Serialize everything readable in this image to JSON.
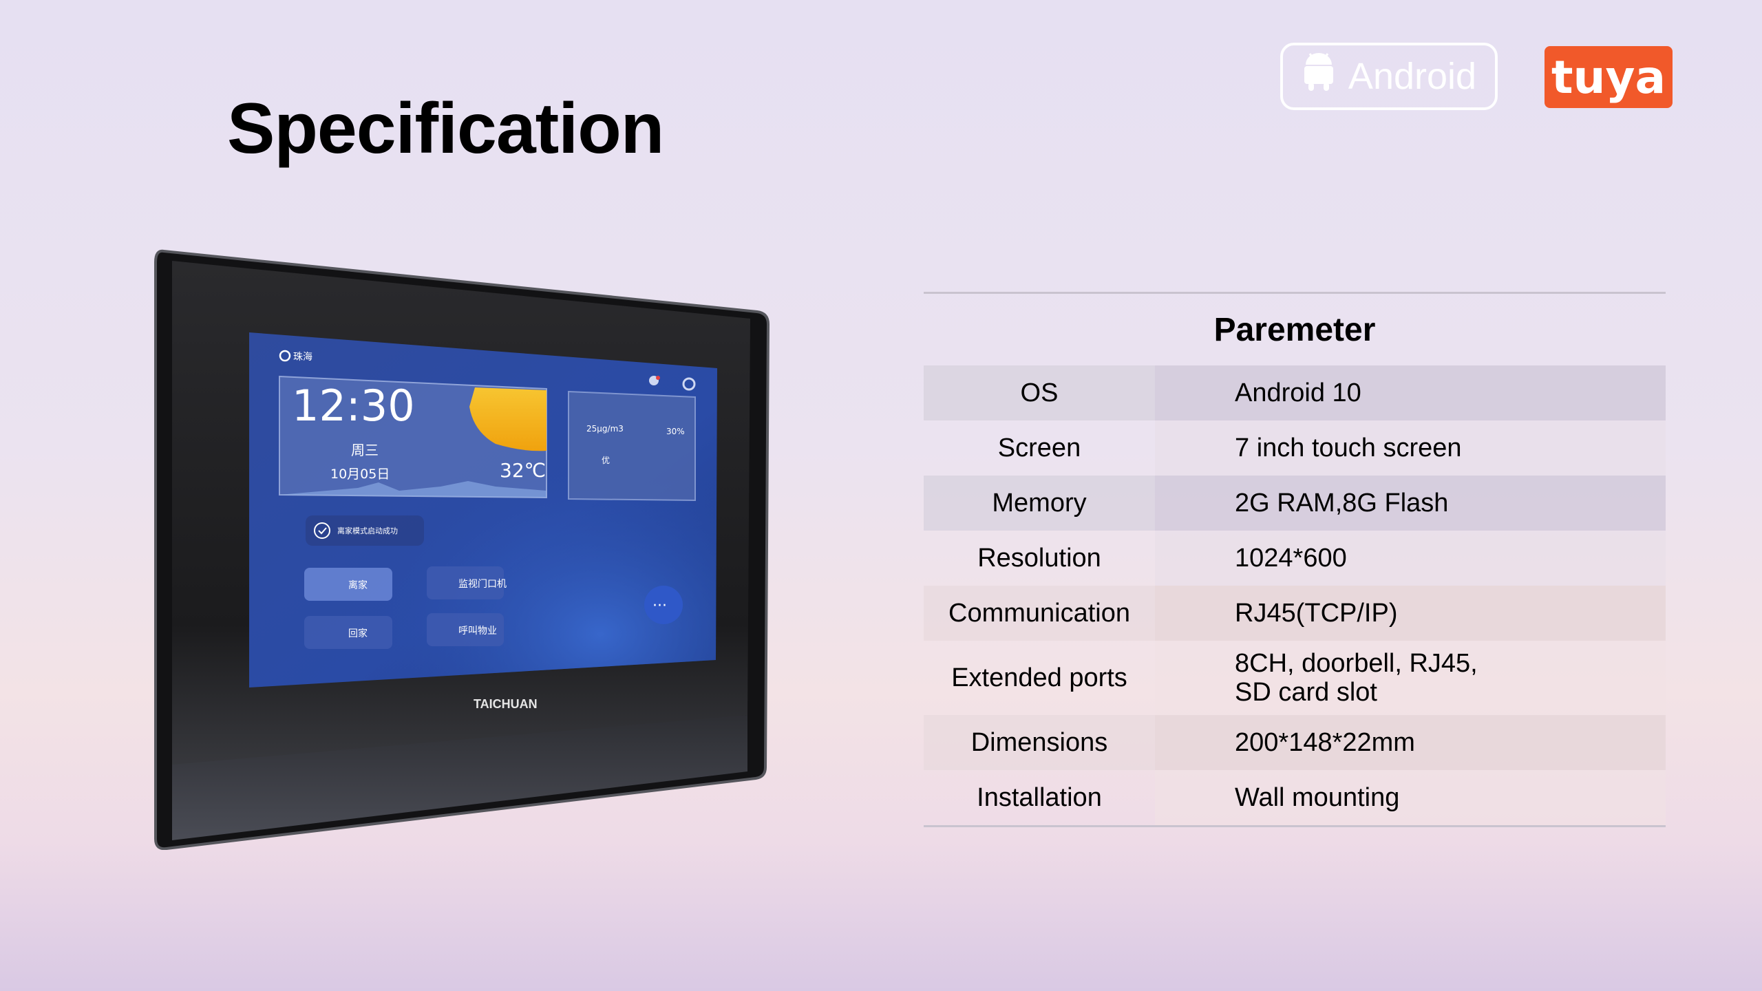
{
  "page": {
    "title": "Specification"
  },
  "badges": {
    "android_label": "Android",
    "tuya_label": "tuya"
  },
  "device": {
    "brand": "TAICHUAN",
    "screen": {
      "location": "珠海",
      "time": "12:30",
      "weekday": "周三",
      "date": "10月05日",
      "temperature": "32℃",
      "pm25": "25μg/m3",
      "humidity": "30%",
      "air_quality": "优",
      "notice": "离家模式启动成功",
      "buttons": [
        {
          "label": "离家"
        },
        {
          "label": "监视门口机"
        },
        {
          "label": "回家"
        },
        {
          "label": "呼叫物业"
        }
      ],
      "more": "···"
    }
  },
  "spec": {
    "header": "Paremeter",
    "rows": [
      {
        "label": "OS",
        "value": "Android 10"
      },
      {
        "label": "Screen",
        "value": "7 inch touch screen"
      },
      {
        "label": "Memory",
        "value": "2G RAM,8G Flash"
      },
      {
        "label": "Resolution",
        "value": "1024*600"
      },
      {
        "label": "Communication",
        "value": "RJ45(TCP/IP)"
      },
      {
        "label": "Extended ports",
        "value_line1": "8CH, doorbell, RJ45,",
        "value_line2": "SD card slot"
      },
      {
        "label": "Dimensions",
        "value": "200*148*22mm"
      },
      {
        "label": "Installation",
        "value": "Wall mounting"
      }
    ]
  },
  "colors": {
    "tuya_orange": "#f1592a",
    "screen_blue": "#2b4aa0",
    "sun_yellow": "#f6b51b"
  }
}
